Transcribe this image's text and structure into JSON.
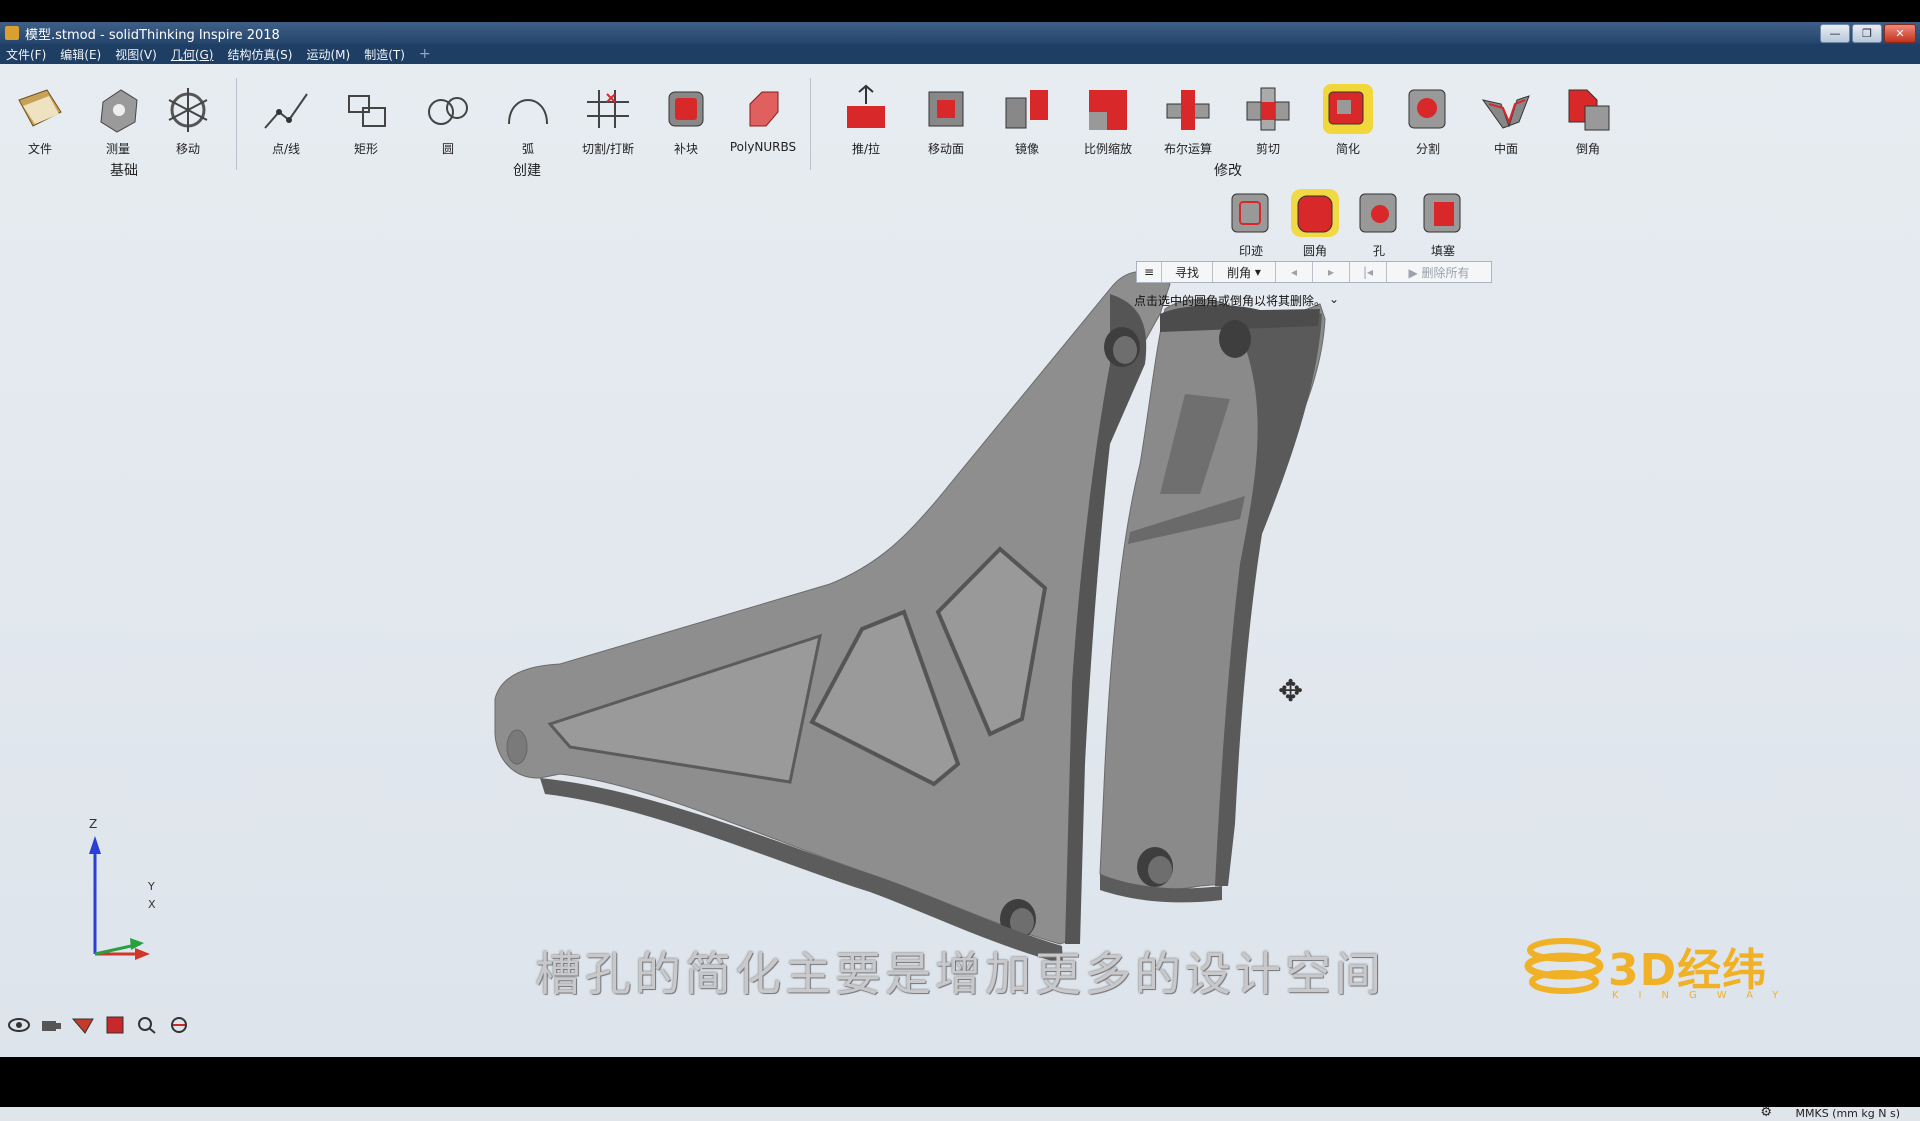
{
  "window": {
    "title": "模型.stmod - solidThinking Inspire 2018",
    "controls": {
      "minimize": "—",
      "restore": "❐",
      "close": "✕"
    }
  },
  "menu": [
    "文件(F)",
    "编辑(E)",
    "视图(V)",
    "几何(G)",
    "结构仿真(S)",
    "运动(M)",
    "制造(T)"
  ],
  "menu_active_index": 3,
  "toolbar": {
    "tools": [
      {
        "label": "文件",
        "icon": "file-icon"
      },
      {
        "label": "测量",
        "icon": "measure-icon"
      },
      {
        "label": "移动",
        "icon": "move-icon"
      },
      {
        "label": "点/线",
        "icon": "point-line-icon"
      },
      {
        "label": "矩形",
        "icon": "rectangle-icon"
      },
      {
        "label": "圆",
        "icon": "circle-icon"
      },
      {
        "label": "弧",
        "icon": "arc-icon"
      },
      {
        "label": "切割/打断",
        "icon": "trim-icon"
      },
      {
        "label": "补块",
        "icon": "patch-icon"
      },
      {
        "label": "PolyNURBS",
        "icon": "polynurbs-icon"
      },
      {
        "label": "推/拉",
        "icon": "push-pull-icon"
      },
      {
        "label": "移动面",
        "icon": "move-face-icon"
      },
      {
        "label": "镜像",
        "icon": "mirror-icon"
      },
      {
        "label": "比例缩放",
        "icon": "scale-icon"
      },
      {
        "label": "布尔运算",
        "icon": "boolean-icon"
      },
      {
        "label": "剪切",
        "icon": "cut-icon"
      },
      {
        "label": "简化",
        "icon": "simplify-icon"
      },
      {
        "label": "分割",
        "icon": "split-icon"
      },
      {
        "label": "中面",
        "icon": "midsurface-icon"
      },
      {
        "label": "倒角",
        "icon": "chamfer-icon"
      }
    ],
    "groups": {
      "base": "基础",
      "create": "创建",
      "modify": "修改"
    }
  },
  "simplify_tools": [
    {
      "label": "印迹",
      "icon": "imprint-icon"
    },
    {
      "label": "圆角",
      "icon": "round-icon"
    },
    {
      "label": "孔",
      "icon": "hole-icon"
    },
    {
      "label": "填塞",
      "icon": "plug-icon"
    }
  ],
  "findbar": {
    "menu": "≡",
    "find": "寻找",
    "mode": "削角",
    "prev": "◂",
    "next": "▸",
    "first": "|◂",
    "delete_all": "▶ 删除所有"
  },
  "hint": {
    "text": "点击选中的圆角或倒角以将其删除。",
    "icon": "⌄"
  },
  "axes": {
    "z": "Z",
    "y": "Y",
    "x": "X"
  },
  "subtitle": "槽孔的简化主要是增加更多的设计空间",
  "logo": {
    "text": "3D经纬",
    "sub": "KINGWAY"
  },
  "bottom_icons": [
    "eye-icon",
    "camera-icon",
    "section-icon",
    "color-icon",
    "zoom-icon",
    "render-icon"
  ],
  "status": {
    "units": "MMKS (mm kg N s)"
  },
  "colors": {
    "title_bar": "#2b4d78",
    "menu_bar": "#1f3e63",
    "viewport": "#e4e9ee",
    "part": "#8c8c8c",
    "accent_red": "#d8282a",
    "logo": "#f1b126"
  }
}
